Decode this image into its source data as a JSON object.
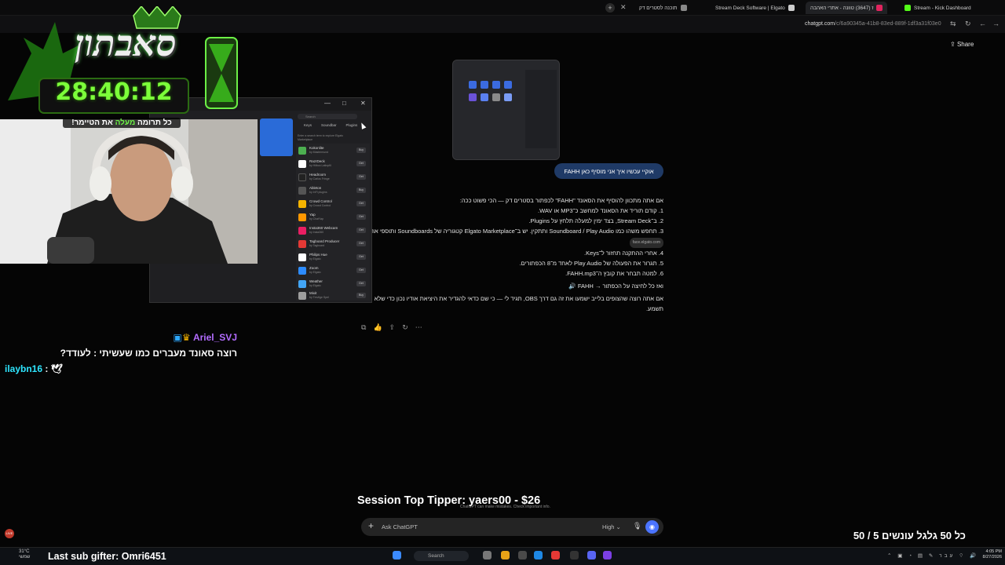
{
  "browser": {
    "tabs": [
      {
        "label": "תוכנה לסטרים דק",
        "color": "#888888"
      },
      {
        "label": "Stream Deck Software | Elgato",
        "color": "#cccccc"
      },
      {
        "label": "ז (3647) טוונה - אתרי האהבה",
        "color": "#e0245e"
      },
      {
        "label": "Stream - Kick Dashboard",
        "color": "#53fc18"
      }
    ],
    "url_host": "chatgpt.com",
    "url_path": "/c/6a90345a-41b8-83ed-889f-1df3a31f03e0"
  },
  "chatgpt": {
    "share_label": "Share",
    "user_message": "אוקיי עכשיו איך אני מוסיף כאן FAHH",
    "answer_intro": "אם אתה מתכוון להוסיף את הסאונד \"FAHH\" לכפתור בסטרים דק — הכי פשוט ככה:",
    "steps": [
      "1. קודם תוריד את הסאונד למחשב כ־MP3 או WAV.",
      "2. ב־Stream Deck, בצד ימין למעלה תלחץ על Plugins.",
      "3. תחפש משהו כמו Soundboard / Play Audio ותתקין. יש ב־Elgato Marketplace קטגוריה של Soundboards ותוספי אודיו.",
      "4. אחרי ההתקנה תחזור ל־Keys.",
      "5. תגרור את הפעולה של Play Audio לאחד מ־8 הכפתורים.",
      "6. למטה תבחר את קובץ ה־FAHH.mp3."
    ],
    "marketplace_pill": "face.elgato.com",
    "final_line": "ואז כל לחיצה על הכפתור → FAHH 🔊",
    "obs_note": "אם אתה רוצה שהצופים בלייב ישמעו את זה גם דרך OBS, תגיד לי — כי שם כדאי להגדיר את היציאת אודיו נכון כדי שלא רק אתה תשמע.",
    "composer_placeholder": "Ask ChatGPT",
    "mode_label": "High ⌄",
    "disclaimer": "ChatGPT can make mistakes. Check important info."
  },
  "streamdeck": {
    "tabs": [
      "Keys",
      "Soundbar",
      "Plugins"
    ],
    "search_placeholder": "Search",
    "hint": "Enter a search term to explore Elgato Marketplace",
    "plugins": [
      {
        "name": "Kokonlite",
        "by": "by Mastermund",
        "action": "Buy",
        "color": "#4caf50"
      },
      {
        "name": "RazrDeck",
        "by": "by Hitbox Latinpfil",
        "action": "Get",
        "color": "#ffffff"
      },
      {
        "name": "Headroom",
        "by": "by Carlos Fringe",
        "action": "Get",
        "color": "#222222"
      },
      {
        "name": "Ableton",
        "by": "by InFl plugins",
        "action": "Buy",
        "color": "#555555"
      },
      {
        "name": "Crowd Control",
        "by": "by Crowd Control",
        "action": "Get",
        "color": "#f5b400"
      },
      {
        "name": "Yap",
        "by": "by ChatYap",
        "action": "Get",
        "color": "#ff9800"
      },
      {
        "name": "Insta360 Webcam",
        "by": "by Insta360",
        "action": "Get",
        "color": "#e91e63"
      },
      {
        "name": "Tagboard Producer",
        "by": "by Tagboard",
        "action": "Get",
        "color": "#e53935"
      },
      {
        "name": "Philips Hue",
        "by": "by Elgato",
        "action": "Get",
        "color": "#ffffff"
      },
      {
        "name": "Zoom",
        "by": "by Elgato",
        "action": "Get",
        "color": "#2d8cff"
      },
      {
        "name": "Weather",
        "by": "by Elgato",
        "action": "Get",
        "color": "#42a5f5"
      },
      {
        "name": "Mixit",
        "by": "by Trevlige Spel",
        "action": "Buy",
        "color": "#9e9e9e"
      }
    ]
  },
  "overlay": {
    "brand": "סאבתון",
    "timer": "28:40:12",
    "donate_pre": "כל תרומה",
    "donate_green": "מעלה",
    "donate_post": "את הטיימר!",
    "chat": [
      {
        "user": "Ariel_SVJ",
        "message": "רוצה סאונד מעברים כמו שעשיתי : לעודד?",
        "color": "#b36cff"
      },
      {
        "user": "ilaybn16",
        "message": "🕊",
        "color": "#2ee6ff"
      }
    ],
    "top_tipper": "Session Top Tipper: yaers00 - $26",
    "last_sub": "Last sub gifter: Omri6451",
    "goal_counter": "כל 50 גלגל עונשים 5 / 50",
    "rec_label": "LIVE"
  },
  "taskbar": {
    "weather_temp": "31°C",
    "weather_desc": "שמשי",
    "search_label": "Search",
    "clock_time": "4:05 PM",
    "clock_date": "8/27/2026",
    "lang": "עבר"
  },
  "colors": {
    "timer_green": "#7cff3a",
    "bubble": "#1f3a66",
    "voice_button": "#4b74ff"
  }
}
